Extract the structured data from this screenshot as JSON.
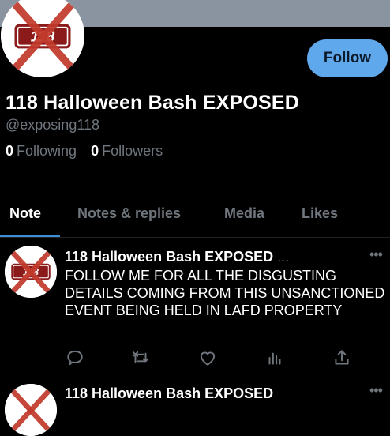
{
  "profile": {
    "avatar_text": "118",
    "display_name": "118 Halloween Bash EXPOSED",
    "handle": "@exposing118",
    "following_count": "0",
    "following_label": "Following",
    "followers_count": "0",
    "followers_label": "Followers",
    "follow_label": "Follow"
  },
  "tabs": [
    {
      "label": "Note",
      "active": true
    },
    {
      "label": "Notes & replies",
      "active": false
    },
    {
      "label": "Media",
      "active": false
    },
    {
      "label": "Likes",
      "active": false
    }
  ],
  "tweet": {
    "name": "118 Halloween Bash EXPOSED",
    "ellipsis": "...",
    "more": "•••",
    "text": "FOLLOW ME FOR ALL THE DISGUSTING DETAILS COMING FROM THIS UNSANCTIONED EVENT BEING HELD IN LAFD PROPERTY",
    "actions": [
      "reply-icon",
      "retweet-icon",
      "like-icon",
      "stats-icon",
      "share-icon"
    ]
  },
  "next_tweet": {
    "name": "118 Halloween Bash EXPOSED",
    "more": "•••"
  },
  "colors": {
    "accent": "#3d8fd6",
    "follow_button": "#5fa8ec",
    "muted": "#6f767d",
    "logo_red": "#c0392b"
  }
}
